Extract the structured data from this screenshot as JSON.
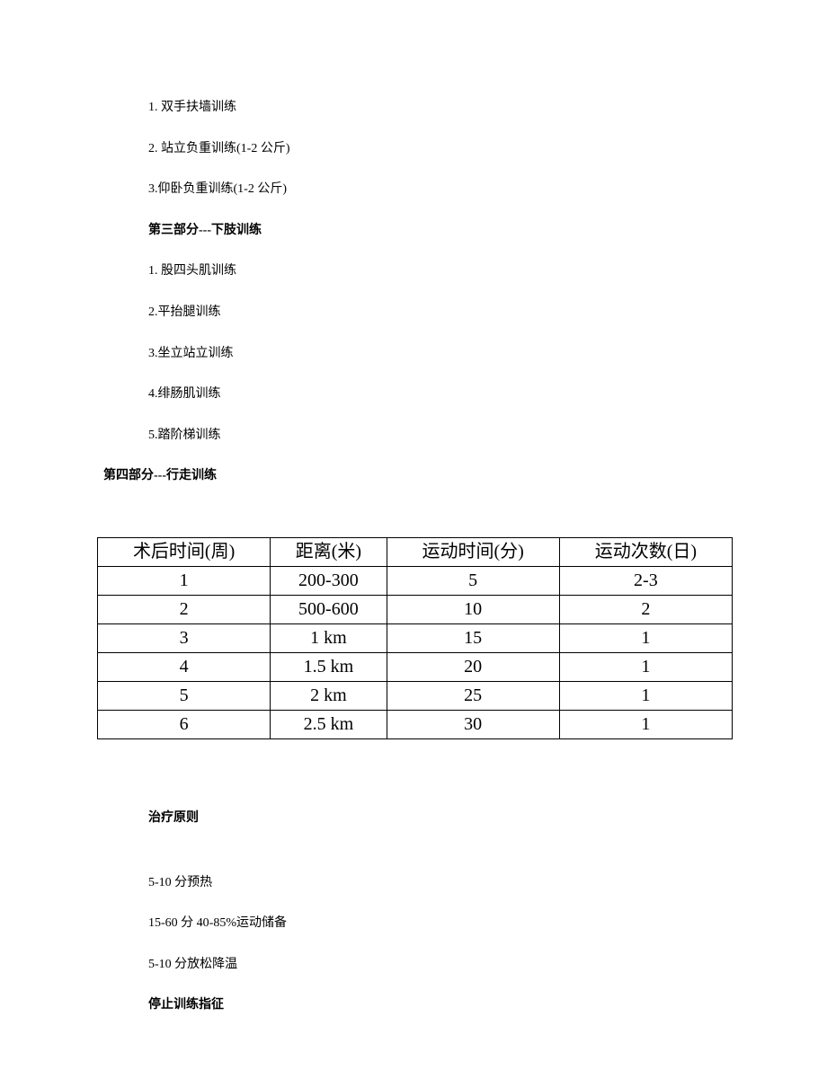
{
  "section2": {
    "items": [
      "1. 双手扶墙训练",
      "2. 站立负重训练(1-2 公斤)",
      "3.仰卧负重训练(1-2 公斤)"
    ]
  },
  "section3": {
    "title": "第三部分---下肢训练",
    "items": [
      "1. 股四头肌训练",
      "2.平抬腿训练",
      "3.坐立站立训练",
      "4.绯肠肌训练",
      "5.踏阶梯训练"
    ]
  },
  "section4": {
    "title": "第四部分---行走训练"
  },
  "chart_data": {
    "type": "table",
    "headers": [
      "术后时间(周)",
      "距离(米)",
      "运动时间(分)",
      "运动次数(日)"
    ],
    "rows": [
      [
        "1",
        "200-300",
        "5",
        "2-3"
      ],
      [
        "2",
        "500-600",
        "10",
        "2"
      ],
      [
        "3",
        "1 km",
        "15",
        "1"
      ],
      [
        "4",
        "1.5 km",
        "20",
        "1"
      ],
      [
        "5",
        "2 km",
        "25",
        "1"
      ],
      [
        "6",
        "2.5 km",
        "30",
        "1"
      ]
    ]
  },
  "principles": {
    "title": "治疗原则",
    "items": [
      "5-10 分预热",
      "15-60 分 40-85%运动储备",
      "5-10 分放松降温"
    ]
  },
  "stop": {
    "title": "停止训练指征"
  }
}
